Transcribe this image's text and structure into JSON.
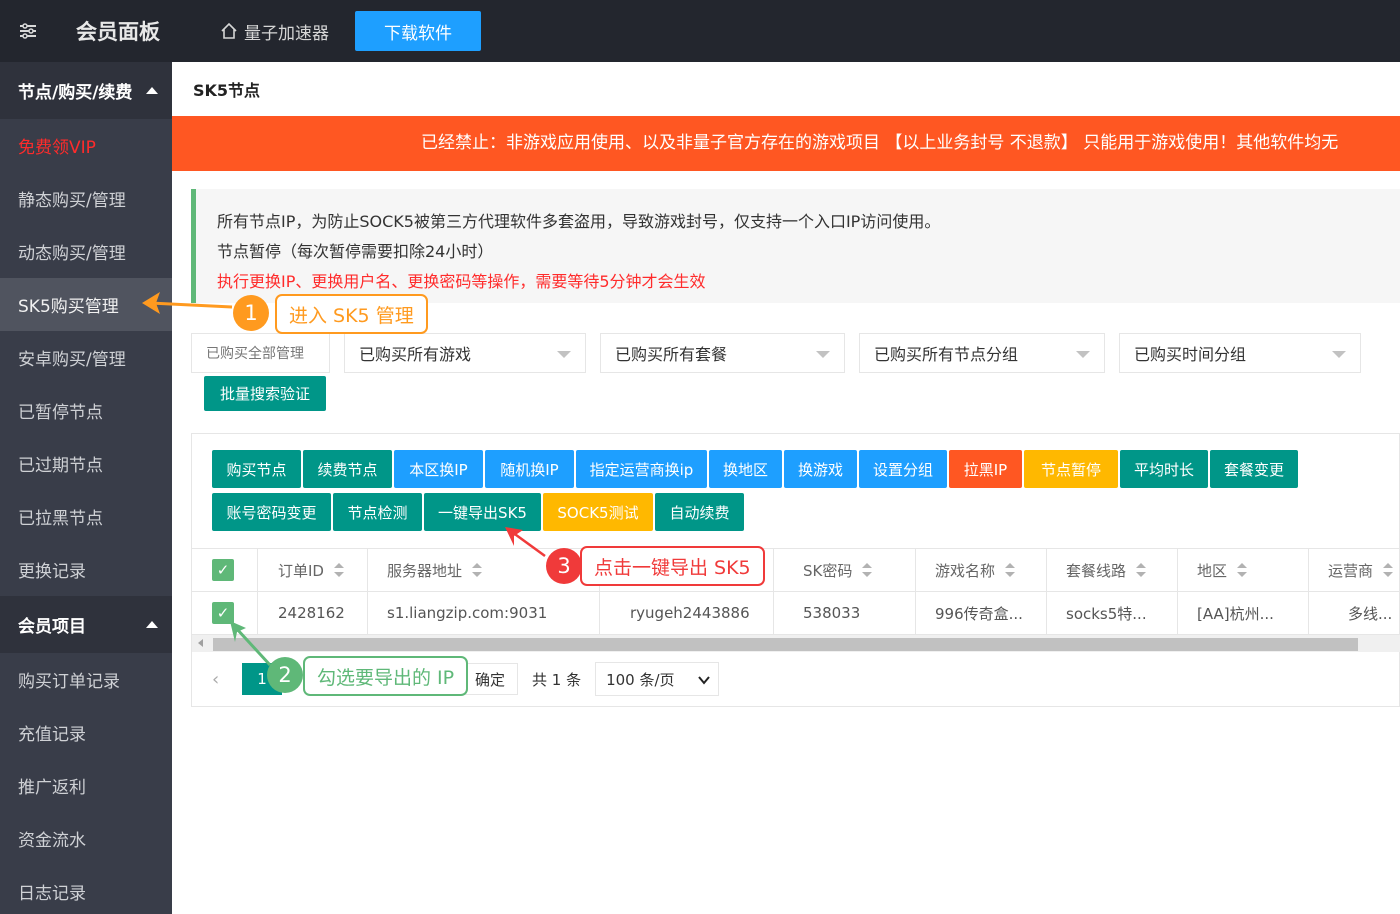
{
  "header": {
    "brand": "会员面板",
    "home_link": "量子加速器",
    "download_button": "下载软件"
  },
  "sidebar": {
    "group1": "节点/购买/续费",
    "items1": [
      "免费领VIP",
      "静态购买/管理",
      "动态购买/管理",
      "SK5购买管理",
      "安卓购买/管理",
      "已暂停节点",
      "已过期节点",
      "已拉黑节点",
      "更换记录"
    ],
    "group2": "会员项目",
    "items2": [
      "购买订单记录",
      "充值记录",
      "推广返利",
      "资金流水",
      "日志记录"
    ]
  },
  "page": {
    "breadcrumb": "SK5节点",
    "notice": "已经禁止：非游戏应用使用、以及非量子官方存在的游戏项目 【以上业务封号 不退款】 只能用于游戏使用！其他软件均无",
    "quote_lines": [
      "所有节点IP，为防止SOCK5被第三方代理软件多套盗用，导致游戏封号，仅支持一个入口IP访问使用。",
      "节点暂停（每次暂停需要扣除24小时）",
      "执行更换IP、更换用户名、更换密码等操作，需要等待5分钟才会生效"
    ]
  },
  "filters": {
    "label": "已购买全部管理",
    "selects": [
      "已购买所有游戏",
      "已购买所有套餐",
      "已购买所有节点分组",
      "已购买时间分组"
    ],
    "batch_button": "批量搜索验证"
  },
  "toolbar": {
    "row1": [
      {
        "label": "购买节点",
        "color": "green"
      },
      {
        "label": "续费节点",
        "color": "green"
      },
      {
        "label": "本区换IP",
        "color": "blue"
      },
      {
        "label": "随机换IP",
        "color": "blue"
      },
      {
        "label": "指定运营商换ip",
        "color": "blue"
      },
      {
        "label": "换地区",
        "color": "blue"
      },
      {
        "label": "换游戏",
        "color": "blue"
      },
      {
        "label": "设置分组",
        "color": "blue"
      },
      {
        "label": "拉黑IP",
        "color": "red"
      },
      {
        "label": "节点暂停",
        "color": "orange"
      },
      {
        "label": "平均时长",
        "color": "green"
      },
      {
        "label": "套餐变更",
        "color": "green"
      }
    ],
    "row2": [
      {
        "label": "账号密码变更",
        "color": "green"
      },
      {
        "label": "节点检测",
        "color": "green"
      },
      {
        "label": "一键导出SK5",
        "color": "green"
      },
      {
        "label": "SOCK5测试",
        "color": "orange"
      },
      {
        "label": "自动续费",
        "color": "green"
      }
    ]
  },
  "table": {
    "columns": [
      "订单ID",
      "服务器地址",
      "",
      "SK密码",
      "游戏名称",
      "套餐线路",
      "地区",
      "运营商"
    ],
    "rows": [
      [
        "2428162",
        "s1.liangzip.com:9031",
        "ryugeh2443886",
        "538033",
        "996传奇盒...",
        "socks5特...",
        "[AA]杭州...",
        "多线..."
      ]
    ]
  },
  "pager": {
    "current": "1",
    "confirm": "确定",
    "total": "共 1 条",
    "page_size": "100 条/页"
  },
  "annotations": {
    "step1_num": "1",
    "step1_text": "进入 SK5 管理",
    "step2_num": "2",
    "step2_text": "勾选要导出的 IP",
    "step3_num": "3",
    "step3_text": "点击一键导出 SK5",
    "color_orange": "#ff9a1f",
    "color_green": "#5fb878",
    "color_red": "#f03a3a"
  }
}
